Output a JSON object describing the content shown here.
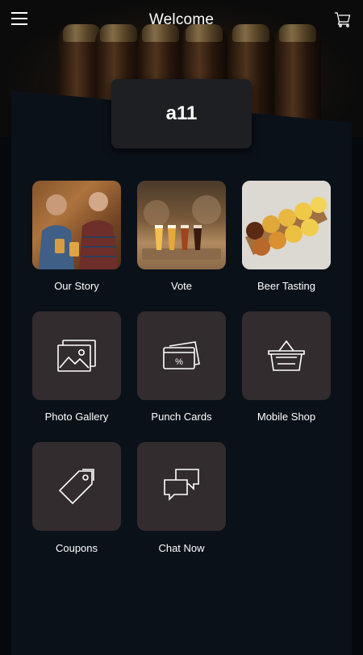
{
  "header": {
    "title": "Welcome"
  },
  "brand": {
    "name": "a11"
  },
  "tiles": [
    {
      "label": "Our Story"
    },
    {
      "label": "Vote"
    },
    {
      "label": "Beer Tasting"
    },
    {
      "label": "Photo Gallery"
    },
    {
      "label": "Punch Cards"
    },
    {
      "label": "Mobile Shop"
    },
    {
      "label": "Coupons"
    },
    {
      "label": "Chat Now"
    }
  ],
  "colors": {
    "background": "#05080d",
    "panel": "#0b1119",
    "tile": "#322c2e",
    "brand_box": "#1d1f23"
  },
  "icons": [
    "menu-icon",
    "cart-icon",
    "image-icon",
    "punch-card-icon",
    "basket-icon",
    "tag-icon",
    "chat-icon"
  ]
}
